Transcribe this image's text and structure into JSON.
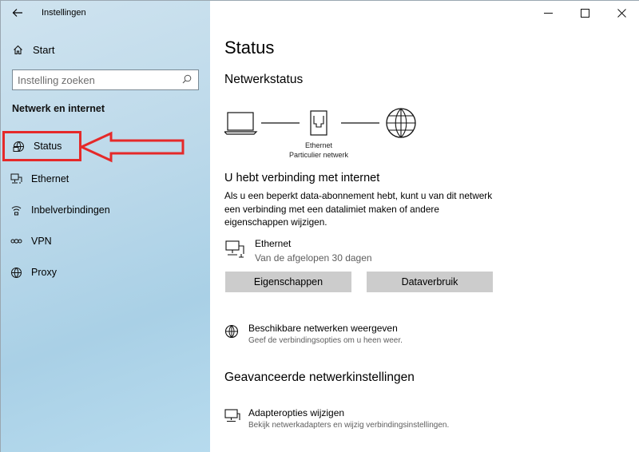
{
  "window": {
    "title": "Instellingen",
    "controls": {
      "minimize": "—",
      "maximize": "☐",
      "close": "✕"
    }
  },
  "sidebar": {
    "back_icon": "back-arrow-icon",
    "home_label": "Start",
    "search_placeholder": "Instelling zoeken",
    "section_title": "Netwerk en internet",
    "items": [
      {
        "label": "Status",
        "icon": "network-status-icon",
        "selected": true
      },
      {
        "label": "Ethernet",
        "icon": "ethernet-icon"
      },
      {
        "label": "Inbelverbindingen",
        "icon": "dialup-icon"
      },
      {
        "label": "VPN",
        "icon": "vpn-icon"
      },
      {
        "label": "Proxy",
        "icon": "globe-icon"
      }
    ],
    "highlight_color": "#e52929"
  },
  "main": {
    "title": "Status",
    "network_status_heading": "Netwerkstatus",
    "diagram": {
      "adapter_label": "Ethernet",
      "network_label": "Particulier netwerk"
    },
    "connection_title": "U hebt verbinding met internet",
    "connection_desc": "Als u een beperkt data-abonnement hebt, kunt u van dit netwerk een verbinding met een datalimiet maken of andere eigenschappen wijzigen.",
    "ethernet": {
      "name": "Ethernet",
      "sub": "Van de afgelopen 30 dagen"
    },
    "buttons": {
      "properties": "Eigenschappen",
      "data_usage": "Dataverbruik"
    },
    "available_networks": {
      "name": "Beschikbare netwerken weergeven",
      "sub": "Geef de verbindingsopties om u heen weer."
    },
    "advanced_heading": "Geavanceerde netwerkinstellingen",
    "adapter_options": {
      "name": "Adapteropties wijzigen",
      "sub": "Bekijk netwerkadapters en wijzig verbindingsinstellingen."
    }
  }
}
